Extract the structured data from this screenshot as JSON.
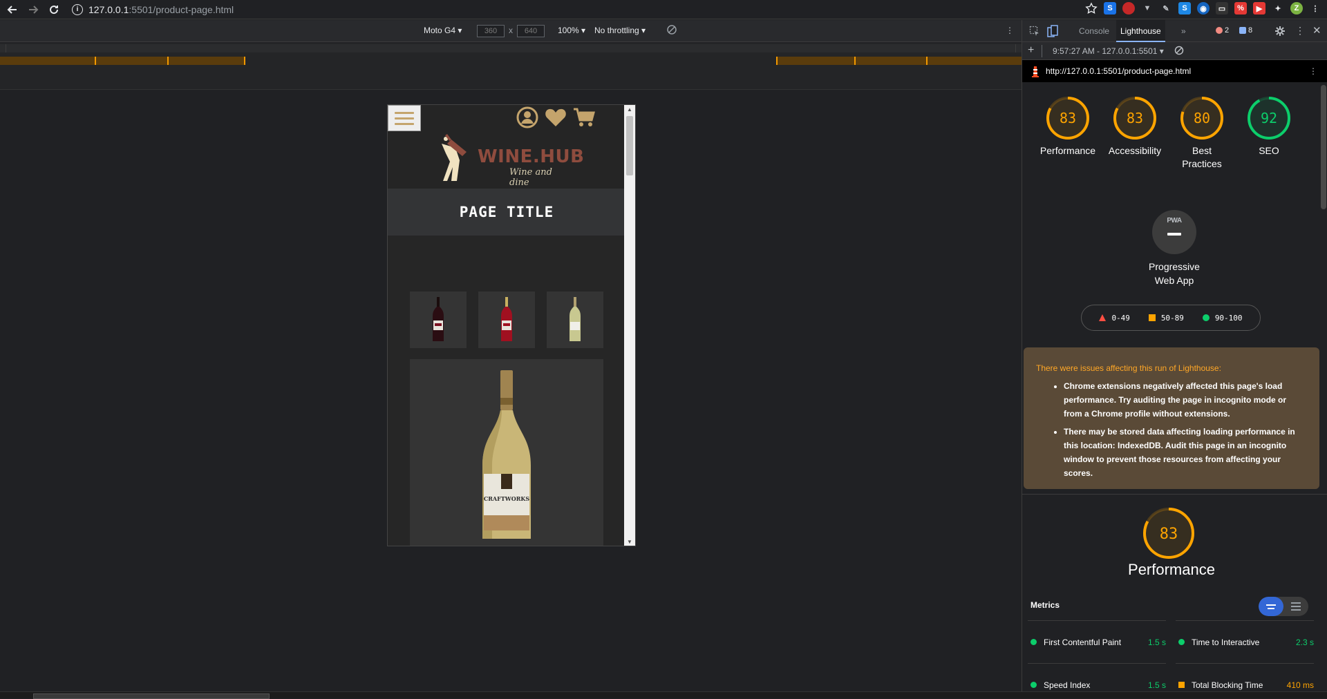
{
  "browser": {
    "url_host": "127.0.0.1",
    "url_rest": ":5501/product-page.html"
  },
  "device_toolbar": {
    "device": "Moto G4",
    "width": "360",
    "height": "640",
    "times": "x",
    "zoom": "100%",
    "throttling": "No throttling"
  },
  "site": {
    "logo_title": "WINE.HUB",
    "logo_tagline": "Wine and dine",
    "page_title": "PAGE TITLE",
    "main_bottle_label": "CRAFTWORKS"
  },
  "devtools": {
    "tabs": [
      "Console",
      "Lighthouse"
    ],
    "active_tab": "Lighthouse",
    "more": "»",
    "error_count": "2",
    "message_count": "8",
    "run_select": "9:57:27 AM - 127.0.0.1:5501",
    "report_url": "http://127.0.0.1:5501/product-page.html"
  },
  "scores": [
    {
      "label": "Performance",
      "value": "83",
      "color": "#ffa400"
    },
    {
      "label": "Accessibility",
      "value": "83",
      "color": "#ffa400"
    },
    {
      "label": "Best Practices",
      "value": "80",
      "color": "#ffa400"
    },
    {
      "label": "SEO",
      "value": "92",
      "color": "#0cce6b"
    }
  ],
  "pwa": {
    "badge": "PWA",
    "label_line1": "Progressive",
    "label_line2": "Web App"
  },
  "legend": [
    {
      "range": "0-49",
      "shape": "triangle",
      "color": "#ff4e42"
    },
    {
      "range": "50-89",
      "shape": "square",
      "color": "#ffa400"
    },
    {
      "range": "90-100",
      "shape": "circle",
      "color": "#0cce6b"
    }
  ],
  "warning": {
    "heading": "There were issues affecting this run of Lighthouse:",
    "items": [
      "Chrome extensions negatively affected this page's load performance. Try auditing the page in incognito mode or from a Chrome profile without extensions.",
      "There may be stored data affecting loading performance in this location: IndexedDB. Audit this page in an incognito window to prevent those resources from affecting your scores."
    ]
  },
  "performance": {
    "score": "83",
    "title": "Performance",
    "metrics_label": "Metrics",
    "metrics": [
      {
        "name": "First Contentful Paint",
        "value": "1.5 s",
        "status": "green"
      },
      {
        "name": "Time to Interactive",
        "value": "2.3 s",
        "status": "green"
      },
      {
        "name": "Speed Index",
        "value": "1.5 s",
        "status": "green"
      },
      {
        "name": "Total Blocking Time",
        "value": "410 ms",
        "status": "orange"
      }
    ]
  },
  "colors": {
    "accent_orange": "#ffa400",
    "accent_green": "#0cce6b",
    "brand_gold": "#c4a46c",
    "brand_maroon": "#8f4c3e"
  }
}
